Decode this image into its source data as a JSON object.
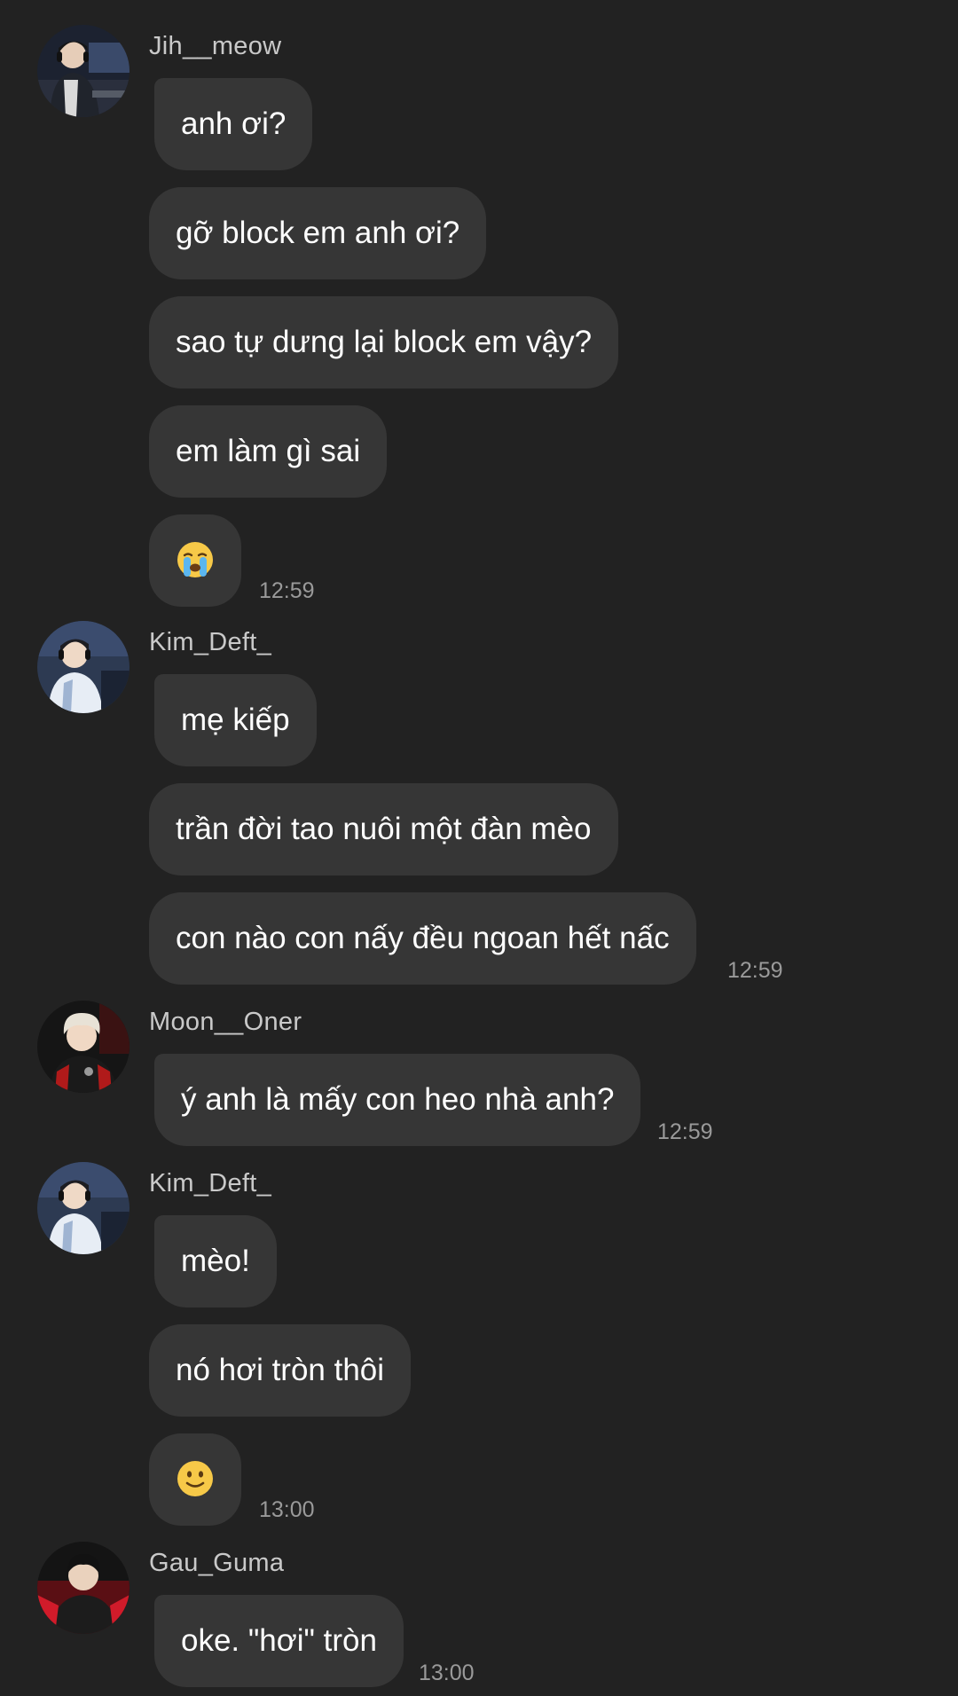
{
  "colors": {
    "background": "#222222",
    "bubble": "#363636",
    "message_text": "#ffffff",
    "sender_name": "#c9c9c9",
    "timestamp": "#9a9a9a"
  },
  "groups": [
    {
      "sender": "Jih__meow",
      "avatar": "avatar-jih-meow",
      "messages": [
        {
          "text": "anh ơi?"
        },
        {
          "text": "gỡ block em anh ơi?"
        },
        {
          "text": "sao tự dưng lại block em vậy?"
        },
        {
          "text": "em làm gì sai"
        },
        {
          "text": "",
          "emoji": "crying-face-emoji"
        }
      ],
      "time": "12:59"
    },
    {
      "sender": "Kim_Deft_",
      "avatar": "avatar-kim-deft",
      "messages": [
        {
          "text": "mẹ kiếp"
        },
        {
          "text": "trần đời tao nuôi một đàn mèo"
        },
        {
          "text": "con nào con nấy đều ngoan hết nấc"
        }
      ],
      "time": "12:59"
    },
    {
      "sender": "Moon__Oner",
      "avatar": "avatar-moon-oner",
      "messages": [
        {
          "text": "ý anh là mấy con heo nhà anh?"
        }
      ],
      "time": "12:59"
    },
    {
      "sender": "Kim_Deft_",
      "avatar": "avatar-kim-deft",
      "messages": [
        {
          "text": "mèo!"
        },
        {
          "text": "nó hơi tròn thôi"
        },
        {
          "text": "",
          "emoji": "slightly-smiling-face-emoji"
        }
      ],
      "time": "13:00"
    },
    {
      "sender": "Gau_Guma",
      "avatar": "avatar-gau-guma",
      "messages": [
        {
          "text": "oke. \"hơi\" tròn"
        }
      ],
      "time": "13:00"
    }
  ]
}
